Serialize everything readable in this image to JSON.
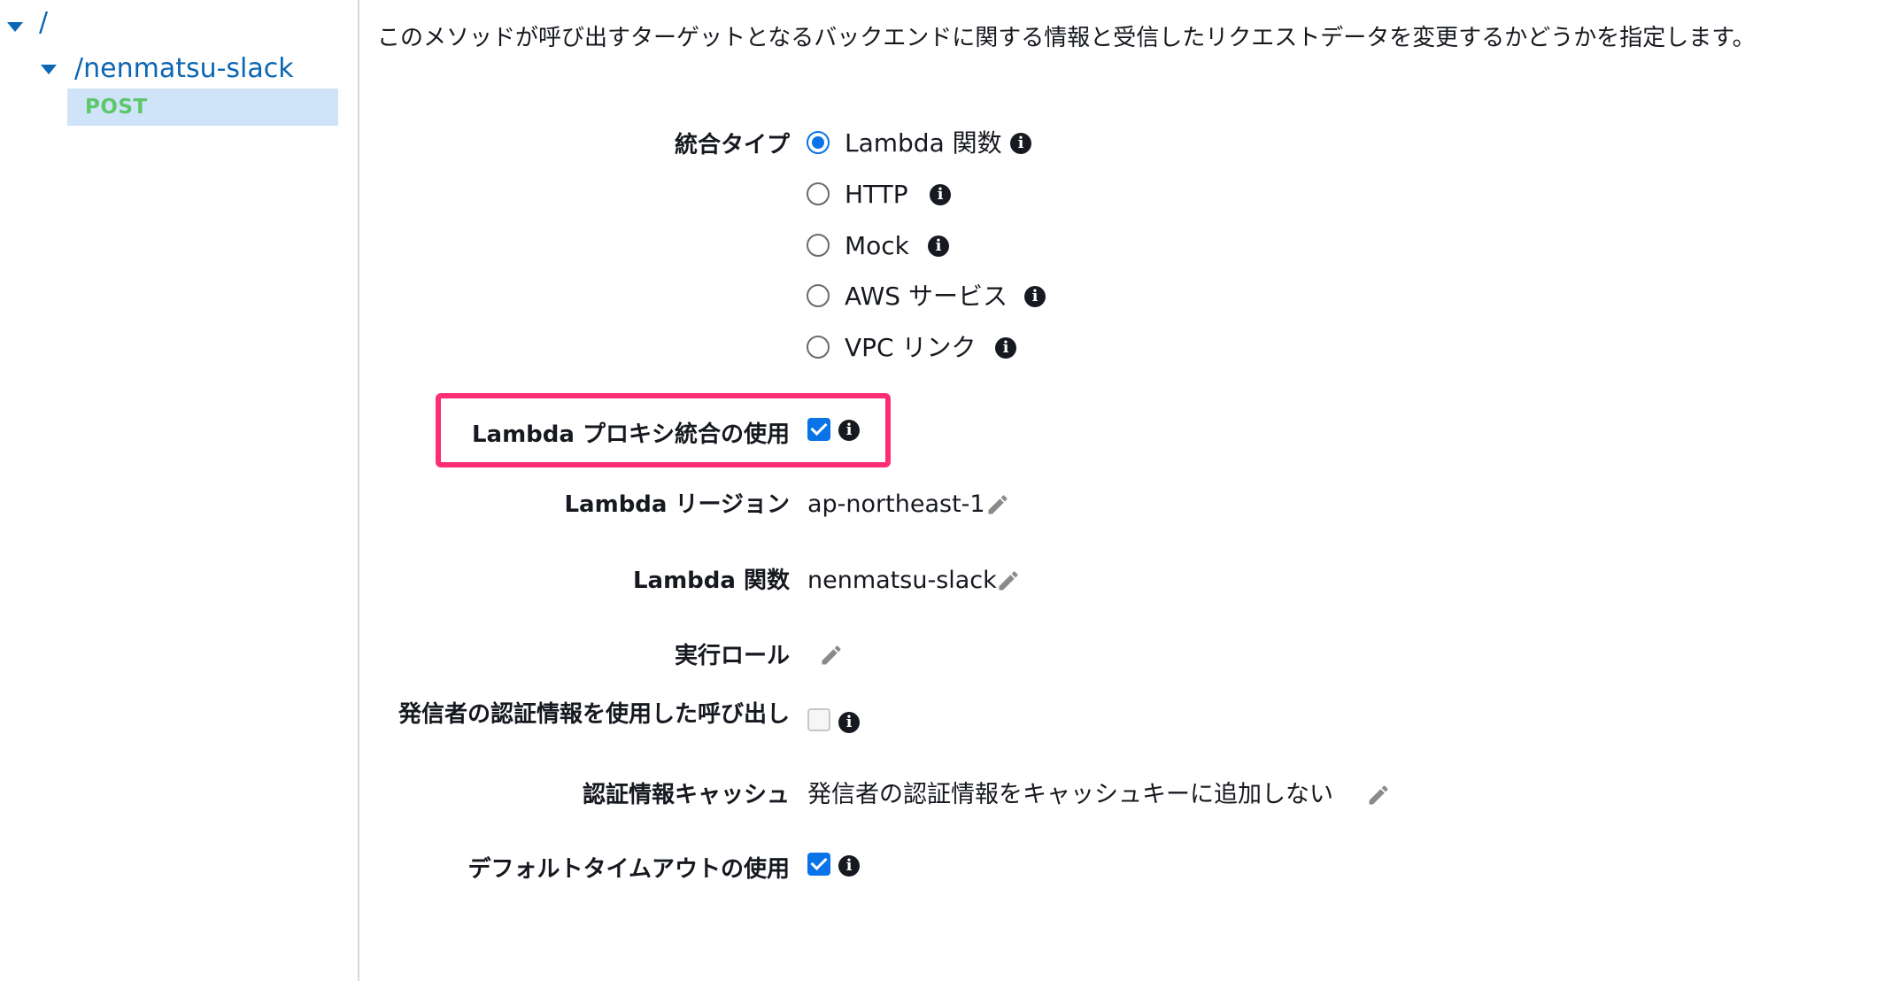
{
  "tree": {
    "root_path": "/",
    "resource_path": "/nenmatsu-slack",
    "method": "POST"
  },
  "description": "このメソッドが呼び出すターゲットとなるバックエンドに関する情報と受信したリクエストデータを変更するかどうかを指定します。",
  "integration_type": {
    "label": "統合タイプ",
    "options": [
      {
        "label": "Lambda 関数",
        "selected": true
      },
      {
        "label": "HTTP",
        "selected": false
      },
      {
        "label": "Mock",
        "selected": false
      },
      {
        "label": "AWS サービス",
        "selected": false
      },
      {
        "label": "VPC リンク",
        "selected": false
      }
    ]
  },
  "fields": {
    "lambda_proxy": {
      "label": "Lambda プロキシ統合の使用",
      "checked": true
    },
    "lambda_region": {
      "label": "Lambda リージョン",
      "value": "ap-northeast-1"
    },
    "lambda_function": {
      "label": "Lambda 関数",
      "value": "nenmatsu-slack"
    },
    "execution_role": {
      "label": "実行ロール",
      "value": ""
    },
    "caller_credentials": {
      "label": "発信者の認証情報を使用した呼び出し",
      "checked": false
    },
    "credentials_cache": {
      "label": "認証情報キャッシュ",
      "value": "発信者の認証情報をキャッシュキーに追加しない"
    },
    "default_timeout": {
      "label": "デフォルトタイムアウトの使用",
      "checked": true
    }
  },
  "icons": {
    "info": "info-icon",
    "edit": "pencil-icon",
    "expand": "caret-down-icon"
  },
  "colors": {
    "link": "#0b66b3",
    "method_post": "#5cc86a",
    "selected_row": "#cfe4f8",
    "accent": "#0a73e8",
    "highlight": "#ff2e73"
  }
}
